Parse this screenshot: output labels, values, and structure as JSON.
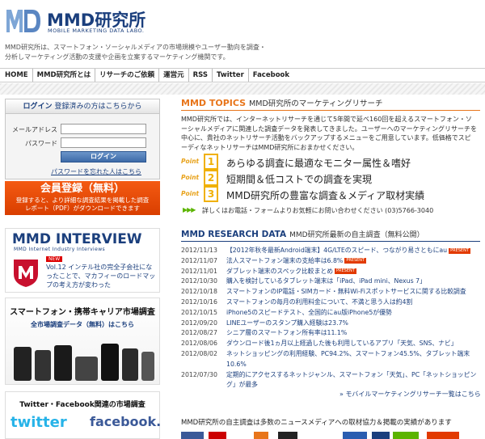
{
  "header": {
    "logo_text": "MMD研究所",
    "logo_sub": "MOBILE MARKETING DATA LABO.",
    "intro": "MMD研究所は、スマートフォン・ソーシャルメディアの市場規模やユーザー動向を調査・分析しマーケティング活動の支援や企画を立案するマーケティング機関です。"
  },
  "nav": [
    "HOME",
    "MMD研究所とは",
    "リサーチのご依頼",
    "運営元",
    "RSS",
    "Twitter",
    "Facebook"
  ],
  "login": {
    "title_bold": "ログイン",
    "title_rest": "登録済みの方はこちらから",
    "email_label": "メールアドレス",
    "password_label": "パスワード",
    "button": "ログイン",
    "forgot": "パスワードを忘れた人はこちら"
  },
  "register": {
    "title": "会員登録（無料）",
    "sub": "登録すると、より詳細な調査結果を掲載した調査レポート（PDF）がダウンロードできます"
  },
  "interview": {
    "logo": "MMD INTERVIEW",
    "tag": "MMD Internet Industry Interviews",
    "new": "NEW",
    "text": "Vol.12 インテル社の完全子会社になったことで、マカフィーのロードマップの考え方が変わった"
  },
  "carrier": {
    "title": "スマートフォン・携帯キャリア市場調査",
    "sub": "全市場調査データ（無料）はこちら"
  },
  "sns": {
    "title": "Twitter・Facebook関連の市場調査",
    "twitter": "twitter",
    "facebook": "facebook."
  },
  "topics": {
    "title": "MMD TOPICS",
    "subtitle": "MMD研究所のマーケティングリサーチ",
    "body": "MMD研究所では、インターネットリサーチを通じて5年間で延べ160回を超えるスマートフォン・ソーシャルメディアに関連した調査データを発表してきました。ユーザーへのマーケティングリサーチを中心に、貴社のネットリサーチ活動をバックアップするメニューをご用意しています。低価格でスピーディなネットリサーチはMMD研究所におまかせください。",
    "points": [
      {
        "label": "Point",
        "num": "1",
        "text": "あらゆる調査に最適なモニター属性＆嗜好"
      },
      {
        "label": "Point",
        "num": "2",
        "text": "短期間＆低コストでの調査を実現"
      },
      {
        "label": "Point",
        "num": "3",
        "text": "MMD研究所の豊富な調査＆メディア取材実績"
      }
    ],
    "contact_arrows": "▶▶▶",
    "contact": "詳しくはお電話・フォームよりお気軽にお問い合わせください (03)5766-3040"
  },
  "research": {
    "title": "MMD RESEARCH DATA",
    "subtitle": "MMD研究所最新の自主調査（無料公開）",
    "items": [
      {
        "date": "2012/11/13",
        "text": "【2012年秋冬最新Android端末】4G/LTEのスピード、つながり易さともにau",
        "badge": "PRESENT"
      },
      {
        "date": "2012/11/07",
        "text": "法人スマートフォン端末の支給率は6.8%",
        "badge": "PRESENT"
      },
      {
        "date": "2012/11/01",
        "text": "ダブレット端末のスペック比較まとめ",
        "badge": "PRESENT"
      },
      {
        "date": "2012/10/30",
        "text": "購入を検討しているタブレット端末は「iPad、iPad mini、Nexus 7」",
        "badge": ""
      },
      {
        "date": "2012/10/18",
        "text": "スマートフォンのIP電話・SIMカード・無料Wi-Fiスポットサービスに関する比較調査",
        "badge": ""
      },
      {
        "date": "2012/10/16",
        "text": "スマートフォンの毎月の利用料金について、不満と思う人は約4割",
        "badge": ""
      },
      {
        "date": "2012/10/15",
        "text": "iPhone5のスピードテスト、全国的にau版iPhone5が優勢",
        "badge": ""
      },
      {
        "date": "2012/09/20",
        "text": "LINEユーザーのスタンプ購入経験は23.7%",
        "badge": ""
      },
      {
        "date": "2012/08/27",
        "text": "シニア層のスマートフォン所有率は11.1%",
        "badge": ""
      },
      {
        "date": "2012/08/06",
        "text": "ダウンロード後1ヵ月以上経過した後も利用しているアプリ「天気、SNS、ナビ」",
        "badge": ""
      },
      {
        "date": "2012/08/02",
        "text": "ネットショッピングの利用経験、PC94.2%、スマートフォン45.5%、タブレット端末10.6%",
        "badge": ""
      },
      {
        "date": "2012/07/30",
        "text": "定期的にアクセスするネットジャンル、スマートフォン「天気」、PC「ネットショッピング」が最多",
        "badge": ""
      }
    ],
    "more": "» モバイルマーケティングリサーチ一覧はこちら"
  },
  "media": "MMD研究所の自主調査は多数のニュースメディアへの取材協力＆掲載の実績があります",
  "colors": {
    "brand": "#1b3f7d",
    "accent": "#e8751a",
    "register": "#e64a0a"
  }
}
